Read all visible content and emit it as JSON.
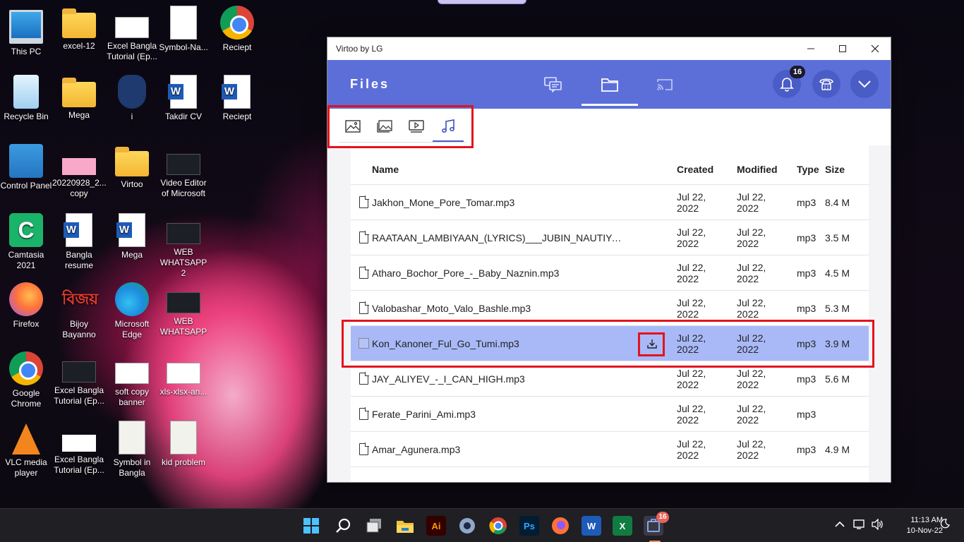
{
  "desktop": {
    "icons": [
      {
        "label": "This PC"
      },
      {
        "label": "excel-12"
      },
      {
        "label": "Excel Bangla Tutorial (Ep..."
      },
      {
        "label": "Symbol-Na..."
      },
      {
        "label": "Reciept"
      },
      {
        "label": "Recycle Bin"
      },
      {
        "label": "Mega"
      },
      {
        "label": "i"
      },
      {
        "label": "Takdir CV"
      },
      {
        "label": "Reciept"
      },
      {
        "label": "Control Panel"
      },
      {
        "label": "20220928_2... copy"
      },
      {
        "label": "Virtoo"
      },
      {
        "label": "Video Editor of Microsoft"
      },
      {
        "label": "Camtasia 2021"
      },
      {
        "label": "Bangla resume"
      },
      {
        "label": "Mega"
      },
      {
        "label": "WEB WHATSAPP 2"
      },
      {
        "label": "Firefox"
      },
      {
        "label": "Bijoy Bayanno"
      },
      {
        "label": "Microsoft Edge"
      },
      {
        "label": "WEB WHATSAPP"
      },
      {
        "label": "Google Chrome"
      },
      {
        "label": "Excel Bangla Tutorial (Ep..."
      },
      {
        "label": "soft copy banner"
      },
      {
        "label": "xls-xlsx-an..."
      },
      {
        "label": "VLC media player"
      },
      {
        "label": "Excel Bangla Tutorial (Ep..."
      },
      {
        "label": "Symbol in Bangla"
      },
      {
        "label": "kid problem"
      }
    ]
  },
  "window": {
    "title": "Virtoo by LG",
    "page_title": "Files",
    "notification_count": "16",
    "accent": "#5c6fd9",
    "selected_row_color": "#a9b9f7",
    "highlight_color": "#e3131e"
  },
  "table": {
    "headers": {
      "name": "Name",
      "created": "Created",
      "modified": "Modified",
      "type": "Type",
      "size": "Size"
    },
    "rows": [
      {
        "name": "Jakhon_Mone_Pore_Tomar.mp3",
        "created_1": "Jul 22,",
        "created_2": "2022",
        "modified_1": "Jul 22,",
        "modified_2": "2022",
        "type": "mp3",
        "size": "8.4 M"
      },
      {
        "name": "RAATAAN_LAMBIYAAN_(LYRICS)___JUBIN_NAUTIYAL,_...",
        "created_1": "Jul 22,",
        "created_2": "2022",
        "modified_1": "Jul 22,",
        "modified_2": "2022",
        "type": "mp3",
        "size": "3.5 M"
      },
      {
        "name": "Atharo_Bochor_Pore_-_Baby_Naznin.mp3",
        "created_1": "Jul 22,",
        "created_2": "2022",
        "modified_1": "Jul 22,",
        "modified_2": "2022",
        "type": "mp3",
        "size": "4.5 M"
      },
      {
        "name": "Valobashar_Moto_Valo_Bashle.mp3",
        "created_1": "Jul 22,",
        "created_2": "2022",
        "modified_1": "Jul 22,",
        "modified_2": "2022",
        "type": "mp3",
        "size": "5.3 M"
      },
      {
        "name": "Kon_Kanoner_Ful_Go_Tumi.mp3",
        "created_1": "Jul 22,",
        "created_2": "2022",
        "modified_1": "Jul 22,",
        "modified_2": "2022",
        "type": "mp3",
        "size": "3.9 M"
      },
      {
        "name": "JAY_ALIYEV_-_I_CAN_HIGH.mp3",
        "created_1": "Jul 22,",
        "created_2": "2022",
        "modified_1": "Jul 22,",
        "modified_2": "2022",
        "type": "mp3",
        "size": "5.6 M"
      },
      {
        "name": "Ferate_Parini_Ami.mp3",
        "created_1": "Jul 22,",
        "created_2": "2022",
        "modified_1": "Jul 22,",
        "modified_2": "2022",
        "type": "mp3",
        "size": ""
      },
      {
        "name": "Amar_Agunera.mp3",
        "created_1": "Jul 22,",
        "created_2": "2022",
        "modified_1": "Jul 22,",
        "modified_2": "2022",
        "type": "mp3",
        "size": "4.9 M"
      }
    ]
  },
  "taskbar": {
    "app_badge": "16",
    "time": "11:13 AM",
    "date": "10-Nov-22"
  }
}
